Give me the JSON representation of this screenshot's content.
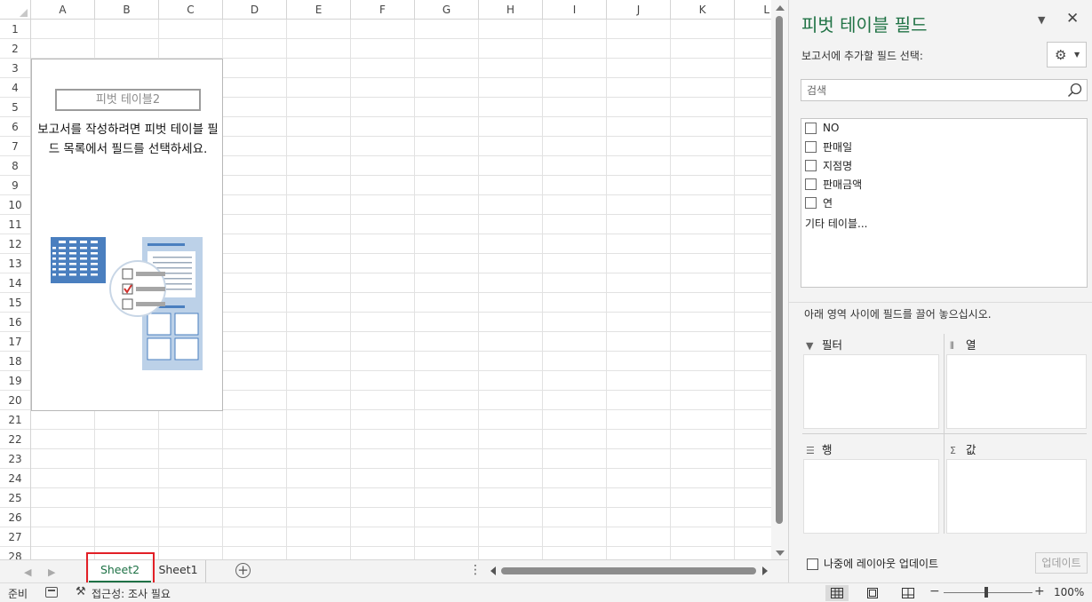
{
  "sheet": {
    "columns": [
      "A",
      "B",
      "C",
      "D",
      "E",
      "F",
      "G",
      "H",
      "I",
      "J",
      "K",
      "L"
    ],
    "rows": [
      "1",
      "2",
      "3",
      "4",
      "5",
      "6",
      "7",
      "8",
      "9",
      "10",
      "11",
      "12",
      "13",
      "14",
      "15",
      "16",
      "17",
      "18",
      "19",
      "20",
      "21",
      "22",
      "23",
      "24",
      "25",
      "26",
      "27",
      "28"
    ],
    "pivot_placeholder": {
      "name": "피벗 테이블2",
      "help_text": "보고서를 작성하려면 피벗 테이블 필드 목록에서 필드를 선택하세요."
    }
  },
  "tabs": {
    "items": [
      {
        "label": "Sheet2",
        "active": true
      },
      {
        "label": "Sheet1",
        "active": false
      }
    ],
    "add_icon": "plus-circle-icon",
    "more_icon": "vertical-ellipsis-icon"
  },
  "status": {
    "ready": "준비",
    "accessibility": "접근성: 조사 필요",
    "zoom": "100%",
    "zoom_minus": "−",
    "zoom_plus": "+"
  },
  "pane": {
    "title": "피벗 테이블 필드",
    "subtitle": "보고서에 추가할 필드 선택:",
    "search_placeholder": "검색",
    "fields": [
      "NO",
      "판매일",
      "지점명",
      "판매금액",
      "연"
    ],
    "more_tables": "기타 테이블...",
    "drag_hint": "아래 영역 사이에 필드를 끌어 놓으십시오.",
    "areas": {
      "filter": "필터",
      "columns": "열",
      "rows": "행",
      "values": "값"
    },
    "defer_label": "나중에 레이아웃 업데이트",
    "update_button": "업데이트",
    "accent": "#217346"
  }
}
